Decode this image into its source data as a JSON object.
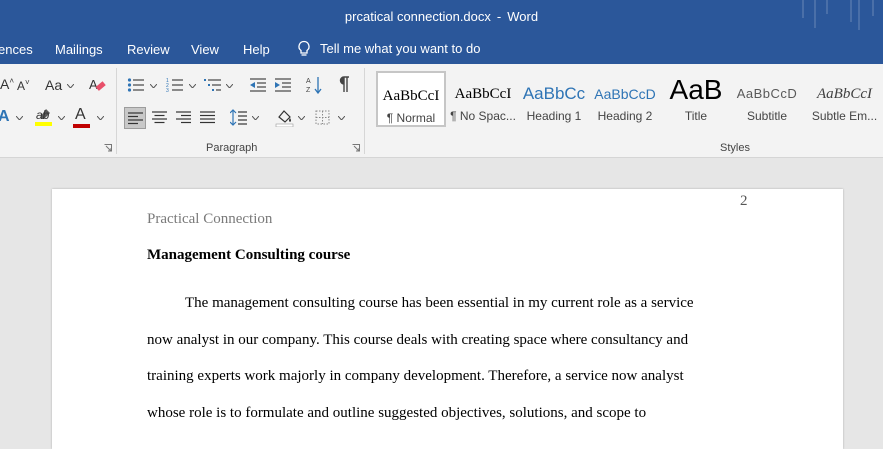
{
  "window": {
    "filename": "prcatical connection.docx",
    "separator": "-",
    "app_name": "Word"
  },
  "tabs": {
    "references_partial": "ences",
    "mailings": "Mailings",
    "review": "Review",
    "view": "View",
    "help": "Help",
    "tell_me": "Tell me what you want to do"
  },
  "ribbon": {
    "font_group": {
      "grow_font_label": "A",
      "shrink_font_label": "A",
      "change_case_label": "Aa",
      "text_effects_label": "A",
      "font_color_label": "A",
      "highlight_color": "#ffff00",
      "font_color": "#c00000"
    },
    "paragraph_label": "Paragraph",
    "styles_label": "Styles",
    "styles": [
      {
        "sample": "AaBbCcI",
        "name": "¶ Normal"
      },
      {
        "sample": "AaBbCcI",
        "name": "¶ No Spac..."
      },
      {
        "sample": "AaBbCc",
        "name": "Heading 1"
      },
      {
        "sample": "AaBbCcD",
        "name": "Heading 2"
      },
      {
        "sample": "AaB",
        "name": "Title"
      },
      {
        "sample": "AaBbCcD",
        "name": "Subtitle"
      },
      {
        "sample": "AaBbCcI",
        "name": "Subtle Em..."
      }
    ]
  },
  "document": {
    "header_text": "Practical Connection",
    "page_number": "2",
    "heading": "Management Consulting course",
    "lines": [
      "The management consulting course has been essential in my current role as a service",
      "now analyst in our company. This course deals with creating space where consultancy and",
      "training experts work majorly in company development. Therefore, a service now analyst",
      "whose role is to formulate and outline suggested objectives, solutions, and scope to"
    ]
  },
  "colors": {
    "title_bar": "#2b579a",
    "ribbon_bg": "#f3f3f3",
    "doc_bg": "#e6e6e6",
    "heading_style_blue": "#2e74b5"
  }
}
